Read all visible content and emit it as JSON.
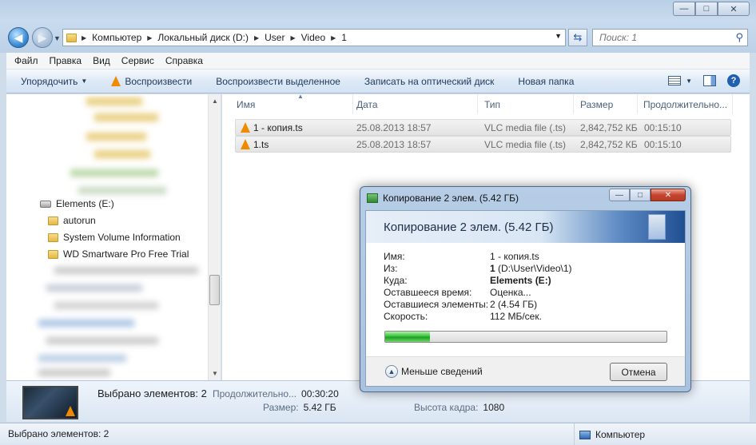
{
  "window": {
    "buttons": {
      "minimize": "—",
      "maximize": "□",
      "close": "✕"
    }
  },
  "nav": {
    "back_icon": "arrow-left-icon",
    "forward_icon": "arrow-right-icon",
    "breadcrumb": [
      "Компьютер",
      "Локальный диск (D:)",
      "User",
      "Video",
      "1"
    ],
    "search_placeholder": "Поиск: 1"
  },
  "menu": [
    "Файл",
    "Правка",
    "Вид",
    "Сервис",
    "Справка"
  ],
  "toolbar": {
    "organize": "Упорядочить",
    "play": "Воспроизвести",
    "play_selected": "Воспроизвести выделенное",
    "burn": "Записать на оптический диск",
    "new_folder": "Новая папка"
  },
  "navpane": {
    "drive": "Elements (E:)",
    "folders": [
      "autorun",
      "System Volume Information",
      "WD Smartware Pro Free Trial"
    ]
  },
  "columns": [
    "Имя",
    "Дата",
    "Тип",
    "Размер",
    "Продолжительно..."
  ],
  "files": [
    {
      "name": "1 - копия.ts",
      "date": "25.08.2013 18:57",
      "type": "VLC media file (.ts)",
      "size": "2,842,752 КБ",
      "duration": "00:15:10"
    },
    {
      "name": "1.ts",
      "date": "25.08.2013 18:57",
      "type": "VLC media file (.ts)",
      "size": "2,842,752 КБ",
      "duration": "00:15:10"
    }
  ],
  "details": {
    "selected": "Выбрано элементов: 2",
    "duration_label": "Продолжительно...",
    "duration_value": "00:30:20",
    "size_label": "Размер:",
    "size_value": "5.42 ГБ",
    "frame_height_label": "Высота кадра:",
    "frame_height_value": "1080"
  },
  "status": {
    "left": "Выбрано элементов: 2",
    "right": "Компьютер"
  },
  "dialog": {
    "title": "Копирование 2 элем. (5.42 ГБ)",
    "heading": "Копирование 2 элем. (5.42 ГБ)",
    "rows": [
      {
        "label": "Имя:",
        "value": "1 - копия.ts"
      },
      {
        "label": "Из:",
        "value_bold": "1",
        "value": " (D:\\User\\Video\\1)"
      },
      {
        "label": "Куда:",
        "value_bold": "Elements (E:)",
        "value": ""
      },
      {
        "label": "Оставшееся время:",
        "value": "Оценка..."
      },
      {
        "label": "Оставшиеся элементы:",
        "value": "2 (4.54 ГБ)"
      },
      {
        "label": "Скорость:",
        "value": "112 МБ/сек."
      }
    ],
    "progress_fraction": 0.16,
    "less_details": "Меньше сведений",
    "cancel": "Отмена"
  }
}
